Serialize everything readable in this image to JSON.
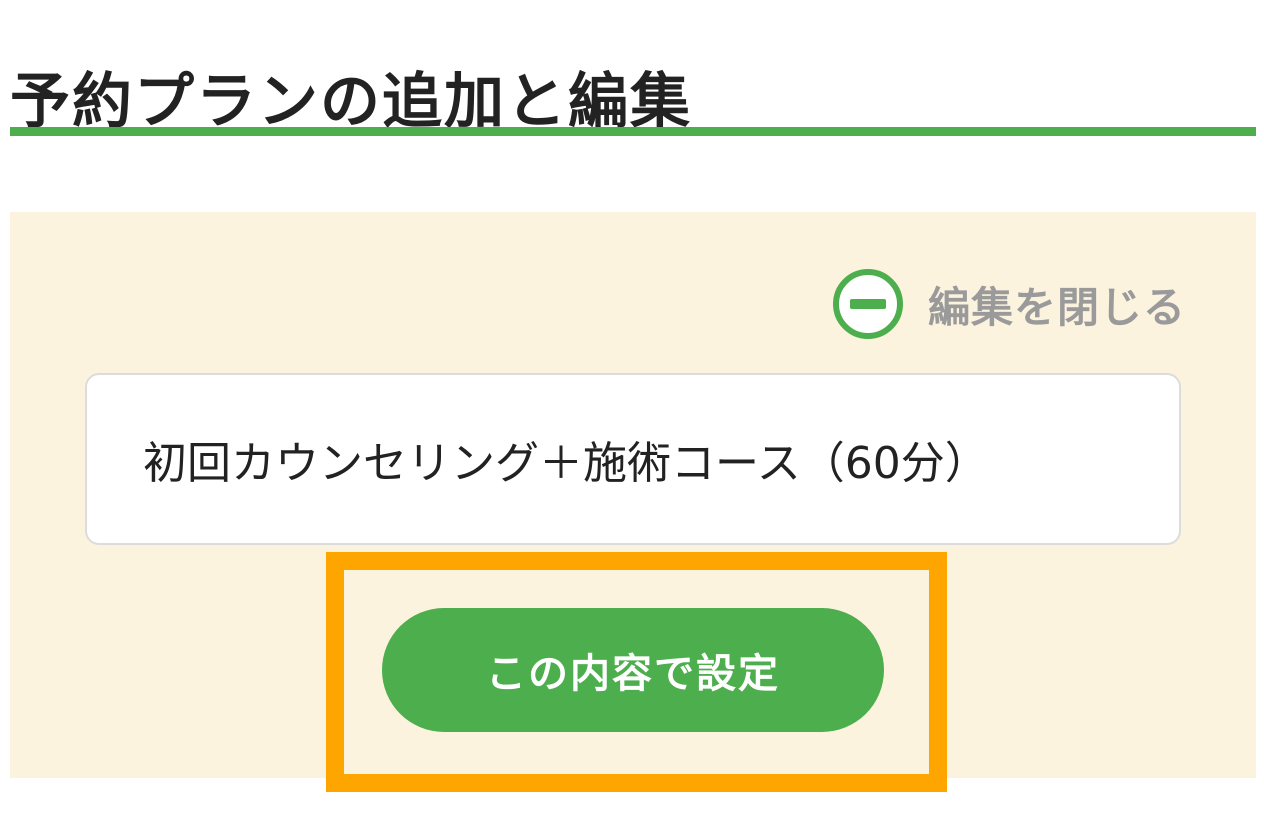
{
  "header": {
    "title": "予約プランの追加と編集"
  },
  "editor": {
    "close_label": "編集を閉じる",
    "close_icon": "minus-circle-icon",
    "plan_name_value": "初回カウンセリング＋施術コース（60分）",
    "submit_label": "この内容で設定"
  },
  "colors": {
    "accent_green": "#4cae4c",
    "panel_background": "#fcf3df",
    "highlight_orange": "#ffa500",
    "muted_text": "#9a9a9a"
  }
}
